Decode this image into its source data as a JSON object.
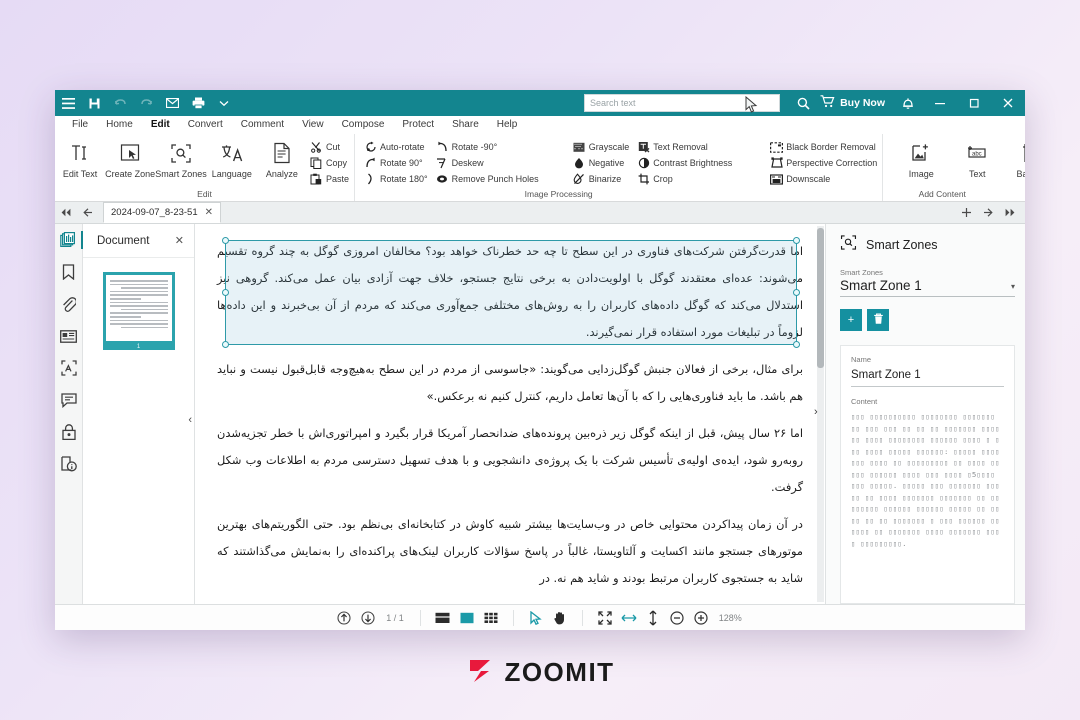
{
  "titlebar": {
    "icons": [
      "menu-icon",
      "save-icon",
      "undo-icon",
      "redo-icon",
      "email-icon",
      "print-icon",
      "chevron-down-icon"
    ],
    "buy_now_label": "Buy Now",
    "accent_color": "#13858f"
  },
  "search": {
    "placeholder": "Search text",
    "value": ""
  },
  "menubar": {
    "items": [
      {
        "label": "File",
        "active": false
      },
      {
        "label": "Home",
        "active": false
      },
      {
        "label": "Edit",
        "active": true
      },
      {
        "label": "Convert",
        "active": false
      },
      {
        "label": "Comment",
        "active": false
      },
      {
        "label": "View",
        "active": false
      },
      {
        "label": "Compose",
        "active": false
      },
      {
        "label": "Protect",
        "active": false
      },
      {
        "label": "Share",
        "active": false
      },
      {
        "label": "Help",
        "active": false
      }
    ]
  },
  "ribbon": {
    "groups": [
      {
        "name": "Edit",
        "label": "Edit",
        "big_buttons": [
          {
            "label": "Edit Text",
            "icon": "edit-text-icon"
          },
          {
            "label": "Create Zone",
            "icon": "create-zone-icon"
          },
          {
            "label": "Smart Zones",
            "icon": "smart-zones-icon"
          },
          {
            "label": "Language",
            "icon": "language-icon"
          },
          {
            "label": "Analyze",
            "icon": "analyze-icon"
          }
        ],
        "small_buttons": [
          {
            "label": "Cut",
            "icon": "scissors-icon"
          },
          {
            "label": "Copy",
            "icon": "copy-icon"
          },
          {
            "label": "Paste",
            "icon": "paste-icon"
          }
        ]
      },
      {
        "name": "Image Processing",
        "label": "Image Processing",
        "columns": [
          [
            {
              "label": "Auto-rotate",
              "icon": "auto-rotate-icon"
            },
            {
              "label": "Rotate 90°",
              "icon": "rotate-cw-icon"
            },
            {
              "label": "Rotate 180°",
              "icon": "rotate-180-icon"
            }
          ],
          [
            {
              "label": "Rotate -90°",
              "icon": "rotate-ccw-icon"
            },
            {
              "label": "Deskew",
              "icon": "deskew-icon"
            },
            {
              "label": "Remove Punch Holes",
              "icon": "punch-holes-icon"
            }
          ],
          [
            {
              "label": "Grayscale",
              "icon": "grayscale-icon"
            },
            {
              "label": "Negative",
              "icon": "negative-icon"
            },
            {
              "label": "Binarize",
              "icon": "binarize-icon"
            }
          ],
          [
            {
              "label": "Text Removal",
              "icon": "text-removal-icon"
            },
            {
              "label": "Contrast Brightness",
              "icon": "contrast-icon"
            },
            {
              "label": "Crop",
              "icon": "crop-icon"
            }
          ],
          [
            {
              "label": "Black Border Removal",
              "icon": "black-border-removal-icon"
            },
            {
              "label": "Perspective Correction",
              "icon": "perspective-correction-icon"
            },
            {
              "label": "Downscale",
              "icon": "downscale-icon"
            }
          ]
        ]
      },
      {
        "name": "Add Content",
        "label": "Add Content",
        "big_buttons": [
          {
            "label": "Image",
            "icon": "add-image-icon"
          },
          {
            "label": "Text",
            "icon": "add-text-icon"
          },
          {
            "label": "Barcode",
            "icon": "barcode-icon"
          }
        ]
      }
    ]
  },
  "tabstrip": {
    "tab_label": "2024-09-07_8-23-51",
    "close_glyph": "✕"
  },
  "sidebar_rail": {
    "items": [
      {
        "name": "pages-icon",
        "active": true
      },
      {
        "name": "bookmark-icon",
        "active": false
      },
      {
        "name": "attachment-icon",
        "active": false
      },
      {
        "name": "id-card-icon",
        "active": false
      },
      {
        "name": "zones-icon",
        "active": false
      },
      {
        "name": "comment-icon",
        "active": false
      },
      {
        "name": "lock-icon",
        "active": false
      },
      {
        "name": "document-info-icon",
        "active": false
      }
    ]
  },
  "thumb_panel": {
    "title": "Document",
    "close_glyph": "✕",
    "page_number": "1"
  },
  "document": {
    "paragraphs": [
      "اما قدرت‌گرفتن شرکت‌های فناوری در این سطح تا چه حد خطرناک خواهد بود؟ مخالفان امروزی گوگل به چند گروه تقسیم می‌شوند: عده‌ای معتقدند گوگل با اولویت‌دادن به برخی نتایج جستجو، خلاف جهت آزادی بیان عمل می‌کند. گروهی نیز استدلال می‌کند که گوگل داده‌های کاربران را به روش‌های مختلفی جمع‌آوری می‌کند که مردم از آن بی‌خبرند و این داده‌ها لزوماً در تبلیغات مورد استفاده قرار نمی‌گیرند.",
      "برای مثال، برخی از فعالان جنبش گوگل‌زدایی می‌گویند: «جاسوسی از مردم در این سطح به‌هیچ‌وجه قابل‌قبول نیست و نباید هم باشد. ما باید فناوری‌هایی را که با آن‌ها تعامل داریم، کنترل کنیم نه برعکس.»",
      "اما ۲۶ سال پیش، قبل از اینکه گوگل زیر ذره‌بین پرونده‌های ضدانحصار آمریکا قرار بگیرد و امپراتوری‌اش با خطر تجزیه‌شدن روبه‌رو شود، ایده‌ی اولیه‌ی تأسیس شرکت با یک پروژه‌ی دانشجویی و با هدف تسهیل دسترسی مردم به اطلاعات وب شکل گرفت.",
      "در آن زمان پیداکردن محتوایی خاص در وب‌سایت‌ها بیشتر شبیه کاوش در کتابخانه‌ای بی‌نظم بود. حتی الگوریتم‌های بهترین موتورهای جستجو مانند اکسایت و آلتاویستا، غالباً در پاسخ سؤالات کاربران لینک‌های پراکنده‌ای را به‌نمایش می‌گذاشتند که شاید به جستجوی کاربران مرتبط بودند و شاید هم نه. در"
    ],
    "selection_color": "#2e9aa8"
  },
  "right_panel": {
    "title": "Smart Zones",
    "title_icon": "smart-zones-icon",
    "select_label": "Smart Zones",
    "select_value": "Smart Zone 1",
    "caret_glyph": "▾",
    "add_button_label": "+",
    "delete_button_icon": "trash-icon",
    "name_label": "Name",
    "name_value": "Smart Zone 1",
    "content_label": "Content",
    "content_value": "▯▯▯ ▯▯▯▯▯▯▯▯▯▯ ▯▯▯▯▯▯▯▯ ▯▯▯▯▯▯▯ ▯▯ ▯▯▯ ▯▯▯ ▯▯ ▯▯ ▯▯ ▯▯▯▯▯▯▯ ▯▯▯▯▯▯ ▯▯▯▯ ▯▯▯▯▯▯▯▯ ▯▯▯▯▯▯ ▯▯▯▯ ▯ ▯▯▯ ▯▯▯▯ ▯▯▯▯▯ ▯▯▯▯▯▯: ▯▯▯▯▯ ▯▯▯▯▯▯▯ ▯▯▯▯ ▯▯ ▯▯▯▯▯▯▯▯▯ ▯▯ ▯▯▯▯ ▯▯▯▯▯ ▯▯▯▯▯▯ ▯▯▯▯ ▯▯▯ ▯▯▯▯ ▯5▯▯▯▯ ▯▯▯ ▯▯▯▯▯. ▯▯▯▯▯ ▯▯▯ ▯▯▯▯▯▯▯ ▯▯▯▯▯ ▯▯ ▯▯▯▯ ▯▯▯▯▯▯▯ ▯▯▯▯▯▯▯ ▯▯ ▯▯ ▯▯▯▯▯▯ ▯▯▯▯▯▯ ▯▯▯▯▯▯ ▯▯▯▯▯ ▯▯ ▯▯▯▯ ▯▯ ▯▯ ▯▯▯▯▯▯▯ ▯ ▯▯▯ ▯▯▯▯▯▯ ▯▯▯▯▯▯ ▯▯ ▯▯▯▯▯▯▯ ▯▯▯▯ ▯▯▯▯▯▯▯ ▯▯▯▯ ▯▯▯▯▯▯▯▯▯.",
    "accent_color": "#1590a0"
  },
  "statusbar": {
    "page_indicator": "1 / 1",
    "zoom_level": "128%",
    "buttons": [
      {
        "name": "previous-page-button",
        "icon": "arrow-up-circle-icon"
      },
      {
        "name": "next-page-button",
        "icon": "arrow-down-circle-icon"
      },
      {
        "name": "single-page-view-button",
        "icon": "single-page-icon"
      },
      {
        "name": "continuous-view-button",
        "icon": "continuous-view-icon"
      },
      {
        "name": "grid-view-button",
        "icon": "grid-view-icon"
      },
      {
        "name": "select-tool-button",
        "icon": "cursor-arrow-icon"
      },
      {
        "name": "pan-tool-button",
        "icon": "hand-icon"
      },
      {
        "name": "fit-page-button",
        "icon": "fit-page-icon"
      },
      {
        "name": "fit-width-button",
        "icon": "fit-width-icon"
      },
      {
        "name": "fit-height-button",
        "icon": "fit-height-icon"
      },
      {
        "name": "zoom-out-button",
        "icon": "zoom-out-icon"
      },
      {
        "name": "zoom-in-button",
        "icon": "zoom-in-icon"
      }
    ]
  },
  "watermark": {
    "text": "ZOOMIT",
    "logo_color": "#e8193c"
  }
}
